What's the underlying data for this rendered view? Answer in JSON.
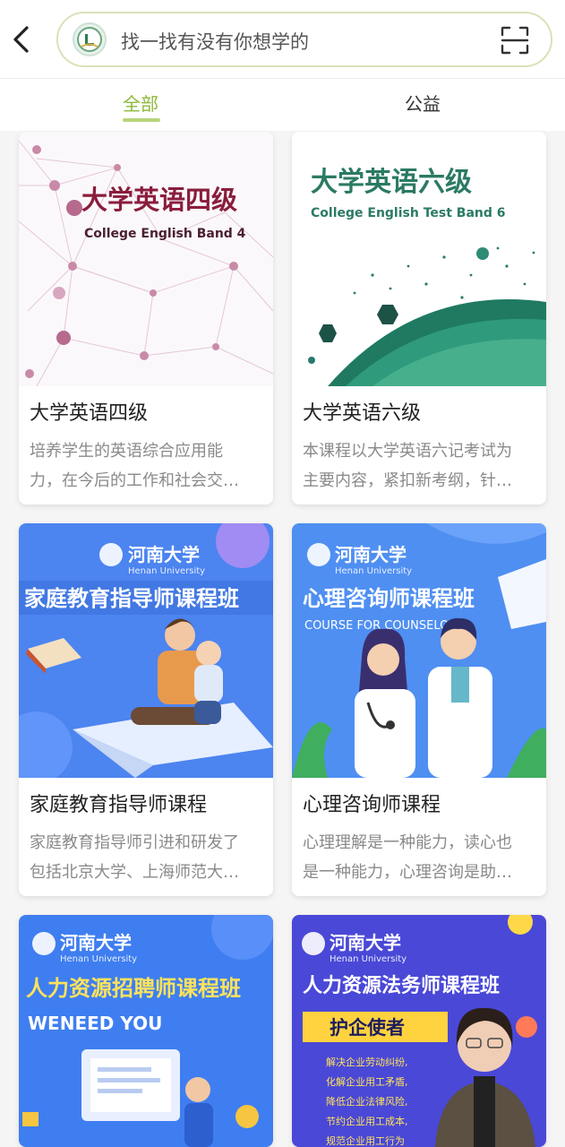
{
  "search": {
    "placeholder": "找一找有没有你想学的"
  },
  "tabs": [
    {
      "label": "全部"
    },
    {
      "label": "公益"
    }
  ],
  "colors": {
    "accent": "#8cb83a",
    "blue_cover": "#3b6fe6",
    "purple_cover": "#5b4fd8"
  },
  "courses": [
    {
      "title": "大学英语四级",
      "desc_lines": [
        "培养学生的英语综合应用能",
        "力，在今后的工作和社会交…"
      ],
      "cover": {
        "heading": "大学英语四级",
        "sub": "College English Band 4"
      }
    },
    {
      "title": "大学英语六级",
      "desc_lines": [
        "本课程以大学英语六记考试为",
        "主要内容，紧扣新考纲，针…"
      ],
      "cover": {
        "heading": "大学英语六级",
        "sub": "College English Test Band 6"
      }
    },
    {
      "title": "家庭教育指导师课程",
      "desc_lines": [
        "家庭教育指导师引进和研发了",
        "包括北京大学、上海师范大…"
      ],
      "cover": {
        "school": "河南大学",
        "school_en": "Henan University",
        "heading": "家庭教育指导师课程班"
      }
    },
    {
      "title": "心理咨询师课程",
      "desc_lines": [
        "心理理解是一种能力，读心也",
        "是一种能力，心理咨询是助…"
      ],
      "cover": {
        "school": "河南大学",
        "school_en": "Henan University",
        "heading": "心理咨询师课程班",
        "sub": "COURSE FOR COUNSELORS"
      }
    },
    {
      "cover": {
        "school": "河南大学",
        "school_en": "Henan University",
        "heading": "人力资源招聘师课程班",
        "sub": "WENEED YOU"
      }
    },
    {
      "cover": {
        "school": "河南大学",
        "school_en": "Henan University",
        "heading": "人力资源法务师课程班",
        "badge": "护企使者",
        "lines": [
          "解决企业劳动纠纷,",
          "化解企业用工矛盾,",
          "降低企业法律风险,",
          "节约企业用工成本,",
          "规范企业用工行为"
        ]
      }
    }
  ]
}
